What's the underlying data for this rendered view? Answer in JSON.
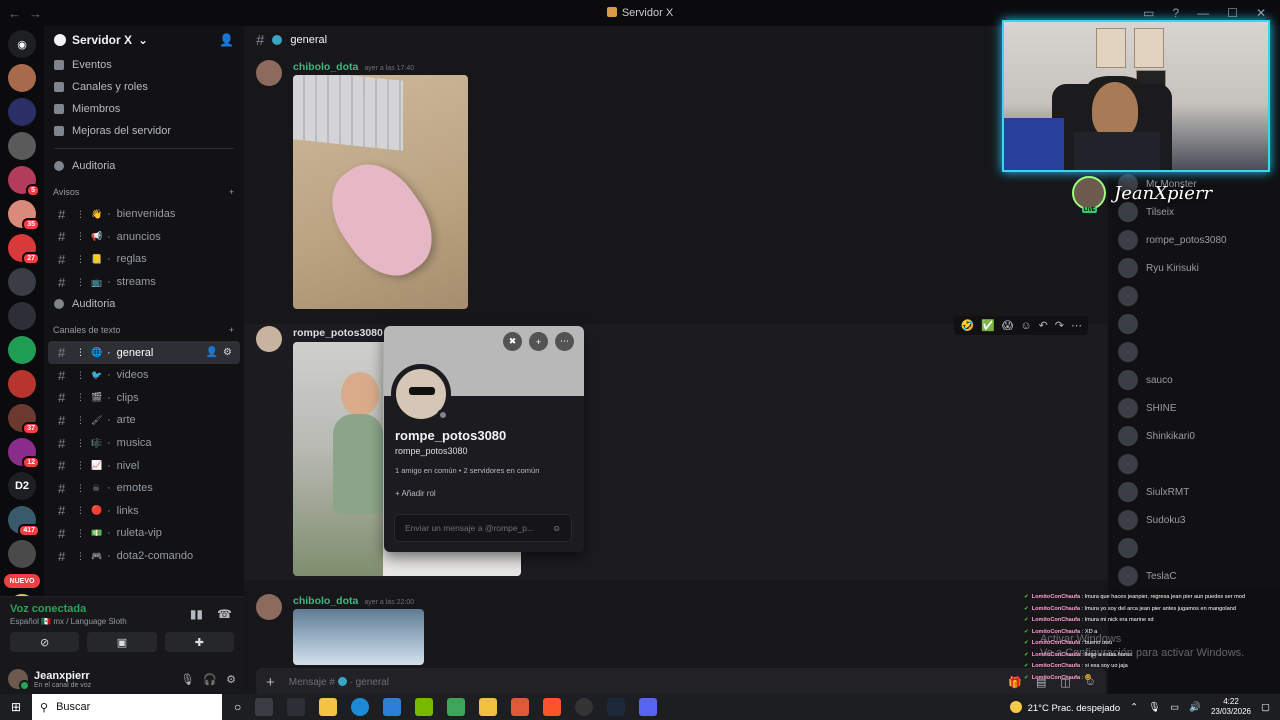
{
  "window": {
    "title": "Servidor X"
  },
  "servers": {
    "items": [
      {
        "badge": ""
      },
      {
        "badge": ""
      },
      {
        "badge": ""
      },
      {
        "badge": "5"
      },
      {
        "badge": "35"
      },
      {
        "badge": "27"
      },
      {
        "badge": ""
      },
      {
        "badge": ""
      },
      {
        "badge": ""
      },
      {
        "badge": ""
      },
      {
        "badge": "37"
      },
      {
        "badge": "12"
      },
      {
        "label": "D2",
        "badge": ""
      },
      {
        "badge": "417"
      },
      {
        "badge": ""
      },
      {
        "badge": "1"
      }
    ],
    "new_label": "NUEVO"
  },
  "guild": {
    "name": "Servidor X",
    "menu": [
      "Eventos",
      "Canales y roles",
      "Miembros",
      "Mejoras del servidor"
    ],
    "audit1": "Auditoria",
    "cat_avisos": "Avisos",
    "avisos": [
      {
        "emoji": "👋",
        "name": "bienvenidas"
      },
      {
        "emoji": "📢",
        "name": "anuncios"
      },
      {
        "emoji": "📒",
        "name": "reglas"
      },
      {
        "emoji": "📺",
        "name": "streams"
      }
    ],
    "audit2": "Auditoria",
    "cat_text": "Canales de texto",
    "text_channels": [
      {
        "emoji": "🌐",
        "name": "general",
        "active": true
      },
      {
        "emoji": "🐦",
        "name": "videos"
      },
      {
        "emoji": "🎬",
        "name": "clips"
      },
      {
        "emoji": "🖌",
        "name": "arte"
      },
      {
        "emoji": "🎼",
        "name": "musica"
      },
      {
        "emoji": "📈",
        "name": "nivel"
      },
      {
        "emoji": "☠",
        "name": "emotes"
      },
      {
        "emoji": "🔴",
        "name": "links"
      },
      {
        "emoji": "💵",
        "name": "ruleta-vip"
      },
      {
        "emoji": "🎮",
        "name": "dota2-comando"
      }
    ]
  },
  "voice": {
    "status": "Voz conectada",
    "detail": "Español 🇲🇽 mx / Language Sloth"
  },
  "user": {
    "name": "Jeanxpierr",
    "status": "En el canal de voz"
  },
  "channel": {
    "name": "general"
  },
  "messages": [
    {
      "author": "chibolo_dota",
      "time": "ayer a las 17:40",
      "color": "#43b581"
    },
    {
      "author": "rompe_potos3080",
      "time": "",
      "color": "#dbdee1"
    },
    {
      "author": "chibolo_dota",
      "time": "ayer a las 22:00",
      "color": "#43b581"
    }
  ],
  "reactions": [
    "🤣",
    "✅",
    "😱"
  ],
  "composer": {
    "placeholder": "Mensaje #",
    "channel": "general"
  },
  "profile": {
    "display_name": "rompe_potos3080",
    "username": "rompe_potos3080",
    "mutual": "1 amigo en común • 2 servidores en común",
    "add_role": "+ Añadir rol",
    "message_placeholder": "Enviar un mensaje a @rompe_p..."
  },
  "stream": {
    "streamer": "JeanXpierr"
  },
  "members_list": [
    {
      "name": "Mr Monster"
    },
    {
      "name": "Tilseix"
    },
    {
      "name": "rompe_potos3080"
    },
    {
      "name": "Ryu Kirisuki"
    },
    {
      "name": ""
    },
    {
      "name": ""
    },
    {
      "name": ""
    },
    {
      "name": "sauco"
    },
    {
      "name": "SHINE"
    },
    {
      "name": "Shinkikari0"
    },
    {
      "name": ""
    },
    {
      "name": "SiulxRMT"
    },
    {
      "name": "Sudoku3"
    },
    {
      "name": ""
    },
    {
      "name": "TeslaC"
    }
  ],
  "twitch_chat": [
    {
      "user": "LomitoConChaufa",
      "text": "lmura que haces jeanpier, regresa jean pier aun puedes ser mod"
    },
    {
      "user": "LomitoConChaufa",
      "text": "lmura yo soy del arca jean pier antes jugamos en mangoland"
    },
    {
      "user": "LomitoConChaufa",
      "text": "lmura mi nick era marine xd"
    },
    {
      "user": "LomitoConChaufa",
      "text": "XD a"
    },
    {
      "user": "LomitoConChaufa",
      "text": "bueno uwu"
    },
    {
      "user": "LomitoConChaufa",
      "text": "llego a estas horas"
    },
    {
      "user": "LomitoConChaufa",
      "text": "si esa soy uo jaja"
    },
    {
      "user": "LomitoConChaufa",
      "text": "🤓"
    }
  ],
  "activate_windows": {
    "line1": "Activar Windows",
    "line2": "Ve a Configuración para activar Windows."
  },
  "taskbar": {
    "search": "Buscar",
    "weather": "21°C  Prac. despejado",
    "time": "4:22",
    "date": "23/03/2026"
  }
}
